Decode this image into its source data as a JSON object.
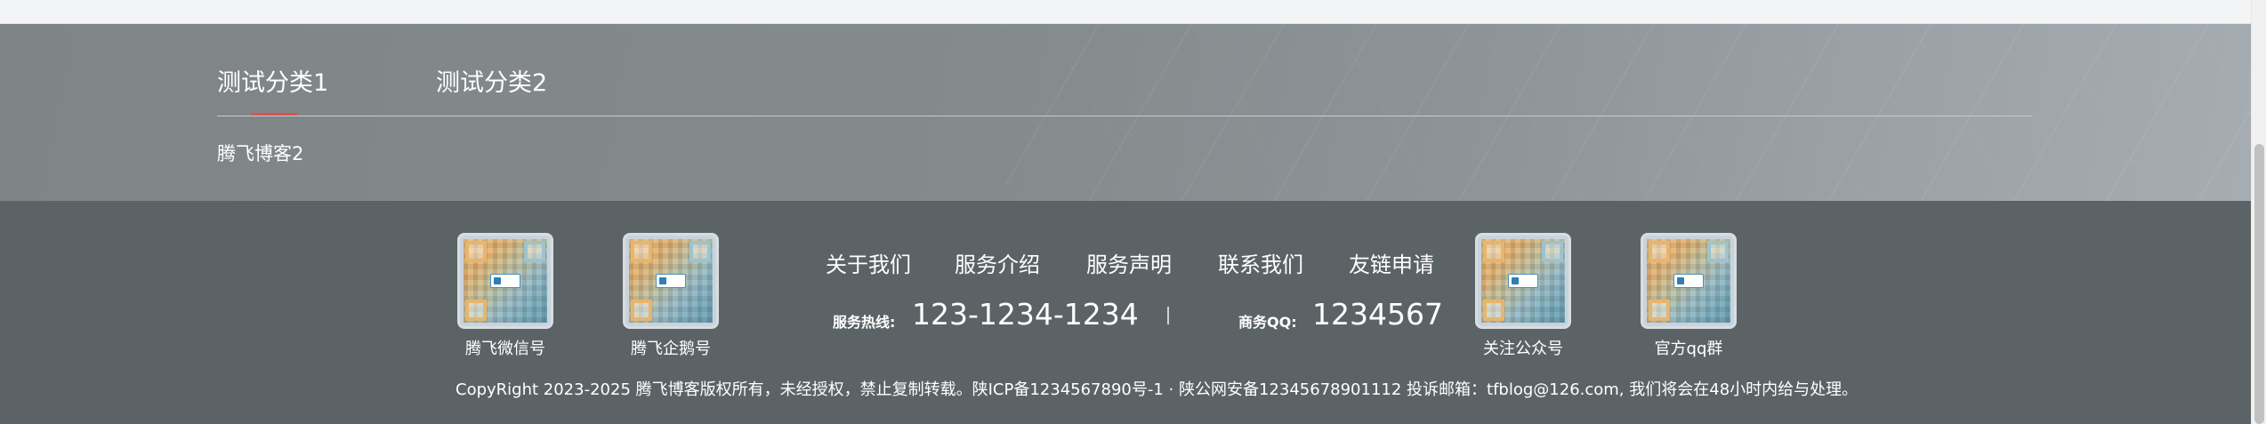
{
  "friend_links": {
    "tabs": [
      {
        "label": "测试分类1"
      },
      {
        "label": "测试分类2"
      }
    ],
    "active_tab_index": 1,
    "items": [
      {
        "label": "腾飞博客2"
      }
    ],
    "accent_color": "#d9534f"
  },
  "footer": {
    "qr_codes": [
      {
        "caption": "腾飞微信号",
        "icon": "qr-code-icon"
      },
      {
        "caption": "腾飞企鹅号",
        "icon": "qr-code-icon"
      },
      {
        "caption": "关注公众号",
        "icon": "qr-code-icon"
      },
      {
        "caption": "官方qq群",
        "icon": "qr-code-icon"
      }
    ],
    "nav": [
      {
        "label": "关于我们"
      },
      {
        "label": "服务介绍"
      },
      {
        "label": "服务声明"
      },
      {
        "label": "联系我们"
      },
      {
        "label": "友链申请"
      }
    ],
    "hotline": {
      "label": "服务热线:",
      "value": "123-1234-1234"
    },
    "separator": "|",
    "business_qq": {
      "label": "商务QQ:",
      "value": "1234567"
    },
    "copyright": "CopyRight 2023-2025 腾飞博客版权所有，未经授权，禁止复制转载。陕ICP备1234567890号-1 · 陕公网安备12345678901112 投诉邮箱：tfblog@126.com, 我们将会在48小时内给与处理。",
    "background_color": "#5c6366"
  }
}
